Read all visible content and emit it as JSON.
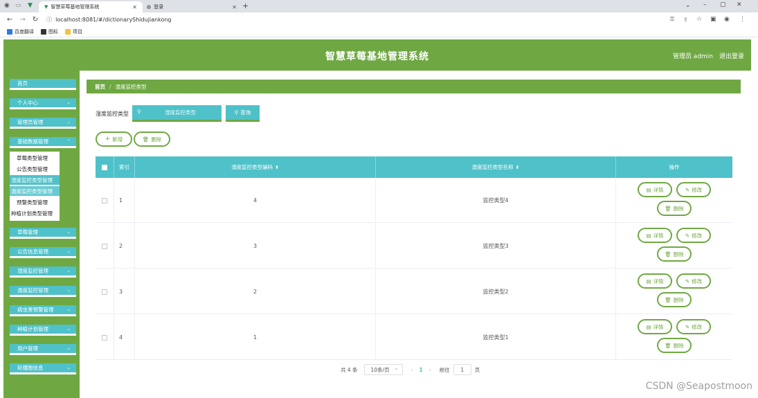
{
  "browser": {
    "tabs": [
      {
        "title": "智慧草莓基地管理系统"
      },
      {
        "title": "登录"
      }
    ],
    "url": "localhost:8081/#/dictionaryShidujiankong",
    "bookmarks": [
      "百度翻译",
      "图标",
      "项目"
    ]
  },
  "header": {
    "title": "智慧草莓基地管理系统",
    "user": "管理员 admin",
    "logout": "退出登录"
  },
  "sidebar": {
    "items": [
      {
        "label": "首页",
        "chevron": false
      },
      {
        "label": "个人中心",
        "chevron": true
      },
      {
        "label": "管理员管理",
        "chevron": true
      },
      {
        "label": "基础数据管理",
        "chevron": true
      },
      {
        "label": "草莓管理",
        "chevron": true
      },
      {
        "label": "公告信息管理",
        "chevron": true
      },
      {
        "label": "湿度监控管理",
        "chevron": true
      },
      {
        "label": "温度监控管理",
        "chevron": true
      },
      {
        "label": "病虫害预警管理",
        "chevron": true
      },
      {
        "label": "种植计划管理",
        "chevron": true
      },
      {
        "label": "用户管理",
        "chevron": true
      },
      {
        "label": "轮播图信息",
        "chevron": true
      }
    ],
    "submenu": [
      {
        "label": "草莓类型管理"
      },
      {
        "label": "公告类型管理"
      },
      {
        "label": "湿度监控类型管理"
      },
      {
        "label": "温度监控类型管理"
      },
      {
        "label": "预警类型管理"
      },
      {
        "label": "种植计划类型管理"
      }
    ]
  },
  "breadcrumb": {
    "home": "首页",
    "separator": "/",
    "current": "湿度监控类型"
  },
  "search": {
    "label": "湿度监控类型",
    "placeholder": "湿度监控类型",
    "query_label": "查询"
  },
  "actions": {
    "add_label": "新增",
    "delete_label": "删除"
  },
  "table": {
    "columns": {
      "index": "索引",
      "code": "湿度监控类型编码",
      "name": "湿度监控类型名称",
      "ops": "操作"
    },
    "rows": [
      {
        "index": "1",
        "code": "4",
        "name": "监控类型4"
      },
      {
        "index": "2",
        "code": "3",
        "name": "监控类型3"
      },
      {
        "index": "3",
        "code": "2",
        "name": "监控类型2"
      },
      {
        "index": "4",
        "code": "1",
        "name": "监控类型1"
      }
    ],
    "row_actions": {
      "detail": "详情",
      "edit": "修改",
      "delete": "删除"
    }
  },
  "pagination": {
    "total": "共 4 条",
    "page_size": "10条/页",
    "current_page": "1",
    "goto_label": "前往",
    "goto_value": "1",
    "page_unit": "页"
  },
  "watermark": "CSDN @Seapostmoon"
}
